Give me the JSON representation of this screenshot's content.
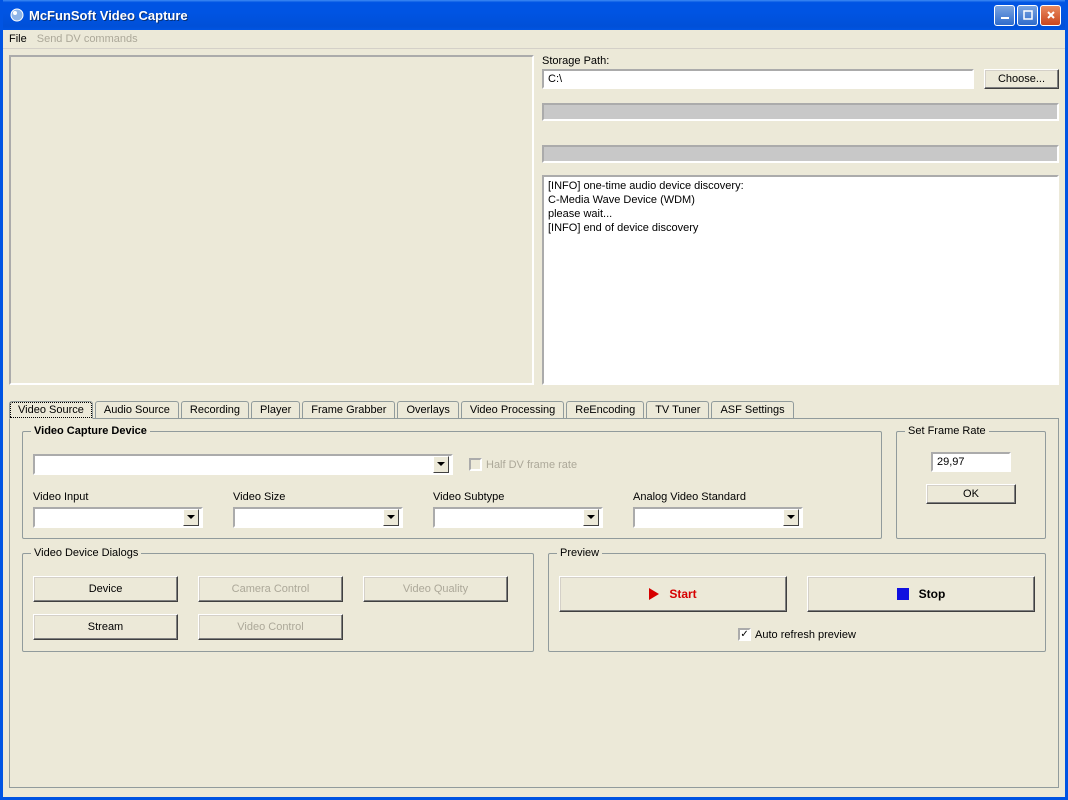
{
  "window": {
    "title": "McFunSoft Video Capture"
  },
  "menubar": {
    "file": "File",
    "send_dv": "Send DV commands"
  },
  "storage": {
    "label": "Storage Path:",
    "path": "C:\\",
    "choose": "Choose..."
  },
  "log": "[INFO] one-time audio device discovery:\nC-Media Wave Device (WDM)\nplease wait...\n[INFO] end of device discovery",
  "tabs": {
    "video_source": "Video Source",
    "audio_source": "Audio Source",
    "recording": "Recording",
    "player": "Player",
    "frame_grabber": "Frame Grabber",
    "overlays": "Overlays",
    "video_processing": "Video Processing",
    "reencoding": "ReEncoding",
    "tv_tuner": "TV Tuner",
    "asf_settings": "ASF Settings"
  },
  "capture": {
    "legend": "Video Capture Device",
    "half_dv": "Half DV frame rate",
    "video_input": "Video Input",
    "video_size": "Video Size",
    "video_subtype": "Video Subtype",
    "analog_standard": "Analog Video Standard"
  },
  "framerate": {
    "legend": "Set Frame Rate",
    "value": "29,97",
    "ok": "OK"
  },
  "dialogs": {
    "legend": "Video Device Dialogs",
    "device": "Device",
    "camera_control": "Camera Control",
    "video_quality": "Video Quality",
    "stream": "Stream",
    "video_control": "Video Control"
  },
  "preview": {
    "legend": "Preview",
    "start": "Start",
    "stop": "Stop",
    "auto_refresh": "Auto refresh preview"
  }
}
